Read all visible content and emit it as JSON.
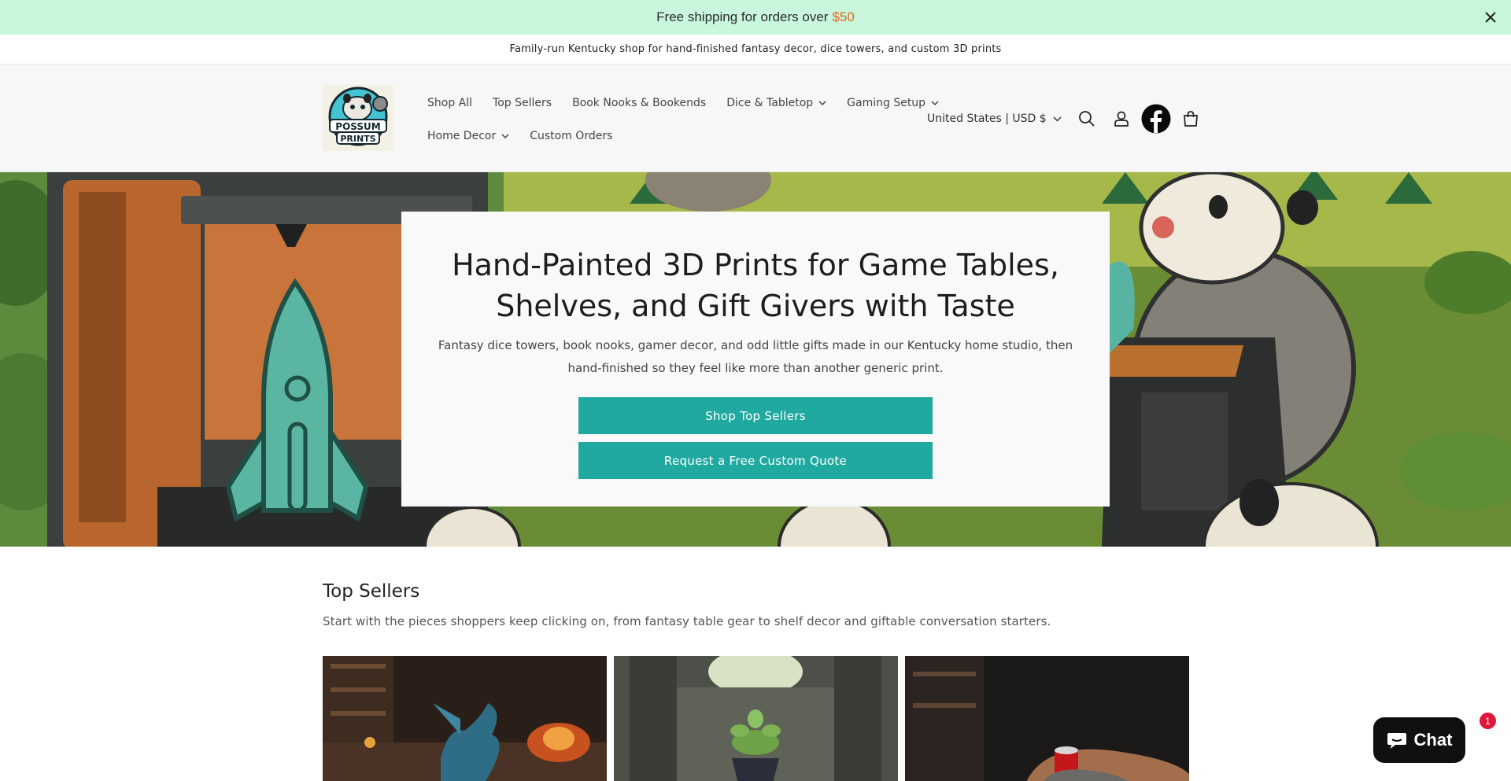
{
  "shipping_bar": {
    "text": "Free shipping for orders over",
    "amount": "$50"
  },
  "announcement": {
    "text": "Family-run Kentucky shop for hand-finished fantasy decor, dice towers, and custom 3D prints"
  },
  "header": {
    "logo_alt": "POSSUM PRINTS",
    "nav_row1": [
      {
        "label": "Shop All",
        "has_dropdown": false
      },
      {
        "label": "Top Sellers",
        "has_dropdown": false
      },
      {
        "label": "Book Nooks & Bookends",
        "has_dropdown": false
      },
      {
        "label": "Dice & Tabletop",
        "has_dropdown": true
      },
      {
        "label": "Gaming Setup",
        "has_dropdown": true
      }
    ],
    "nav_row2": [
      {
        "label": "Home Decor",
        "has_dropdown": true
      },
      {
        "label": "Custom Orders",
        "has_dropdown": false
      }
    ],
    "country_selector": "United States | USD $",
    "icons": [
      "search-icon",
      "account-icon",
      "facebook-icon",
      "cart-icon"
    ]
  },
  "hero": {
    "title": "Hand-Painted 3D Prints for Game Tables, Shelves, and Gift Givers with Taste",
    "subtitle": "Fantasy dice towers, book nooks, gamer decor, and odd little gifts made in our Kentucky home studio, then hand-finished so they feel like more than another generic print.",
    "primary_button": "Shop Top Sellers",
    "secondary_button": "Request a Free Custom Quote"
  },
  "top_sellers": {
    "heading": "Top Sellers",
    "description": "Start with the pieces shoppers keep clicking on, from fantasy table gear to shelf decor and giftable conversation starters."
  },
  "chat": {
    "label": "Chat",
    "badge": "1"
  },
  "colors": {
    "shipping_bar_bg": "#c9f7dc",
    "shipping_amount": "#e0631f",
    "button_teal": "#1fa9a0",
    "chat_bg": "#0f1111",
    "chat_badge": "#e0163a"
  }
}
